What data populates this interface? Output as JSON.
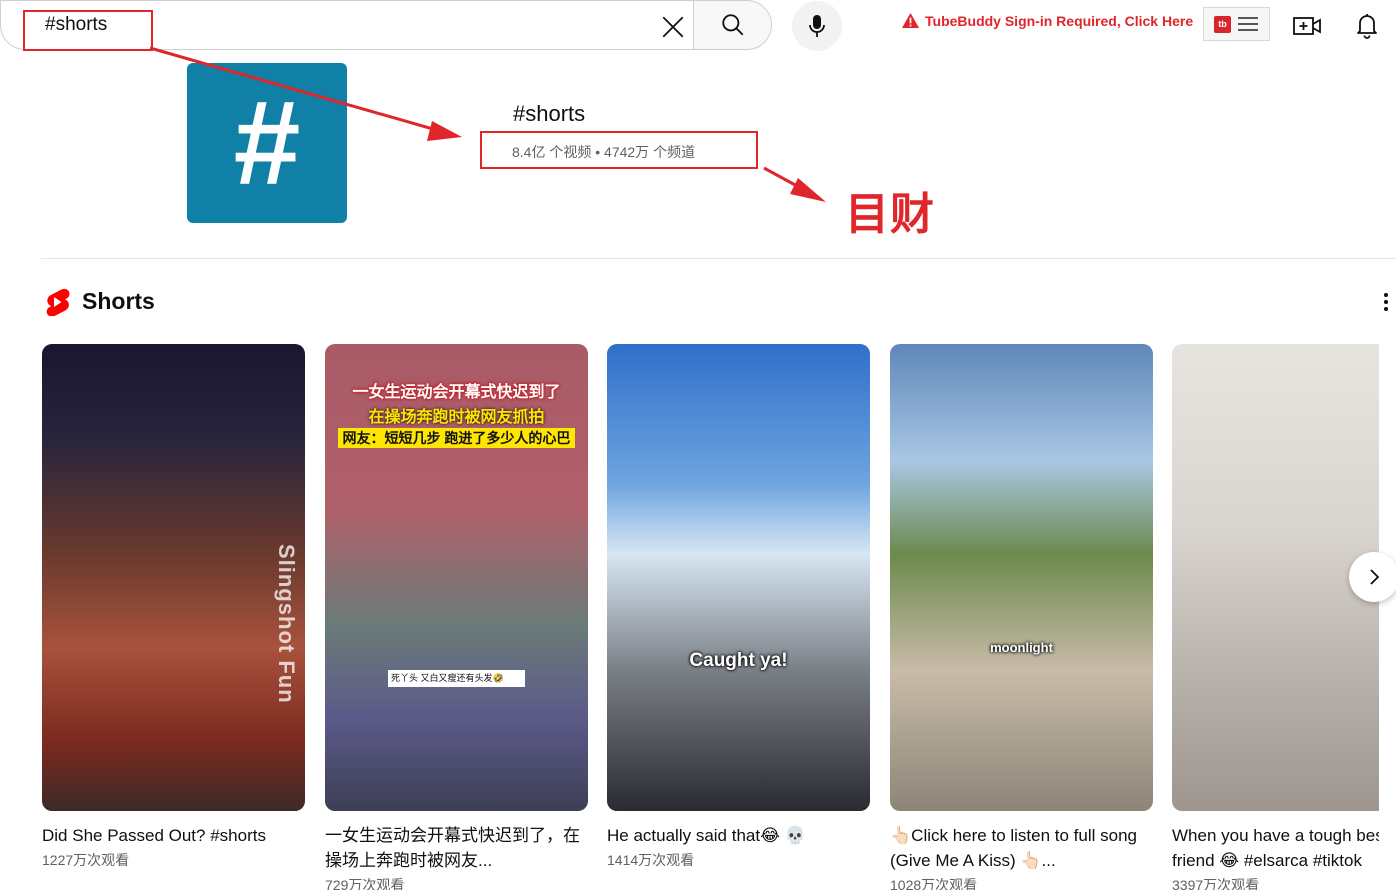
{
  "search": {
    "query": "#shorts"
  },
  "tubebuddy": {
    "warning_text": "TubeBuddy Sign-in Required, Click Here",
    "logo_text": "tb"
  },
  "annotation": {
    "label": "目财",
    "color": "#e0262b"
  },
  "hashtag": {
    "symbol": "#",
    "title": "#shorts",
    "stats": "8.4亿 个视频 • 4742万 个频道",
    "tile_color": "#1180a6"
  },
  "shelf": {
    "title": "Shorts",
    "cards": [
      {
        "title": "Did She Passed Out? #shorts",
        "views": "1227万次观看",
        "overlay_text": "Slingshot Fun"
      },
      {
        "title": "一女生运动会开幕式快迟到了，在操场上奔跑时被网友...",
        "views": "729万次观看",
        "overlay_line1": "一女生运动会开幕式快迟到了",
        "overlay_line2": "在操场奔跑时被网友抓拍",
        "overlay_line3": "网友：短短几步 跑进了多少人的心巴",
        "overlay_caption": "死丫头 又白又瘦还有头发🤣"
      },
      {
        "title": "He actually said that😂 💀",
        "views": "1414万次观看",
        "overlay_caption": "Caught ya!"
      },
      {
        "title": "👆🏻Click here to listen to full song (Give Me A Kiss) 👆🏻...",
        "views": "1028万次观看",
        "overlay_caption": "moonlight"
      },
      {
        "title": "When you have a tough best friend 😂 #elsarca #tiktok",
        "views": "3397万次观看"
      }
    ]
  }
}
